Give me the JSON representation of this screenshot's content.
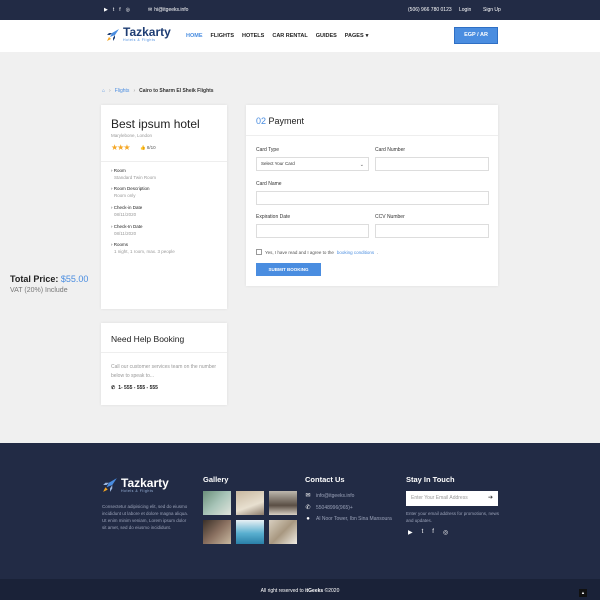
{
  "topbar": {
    "social_icons": [
      "youtube-icon",
      "twitter-icon",
      "facebook-icon",
      "instagram-icon"
    ],
    "email": "hi@itgeeks.info",
    "phone": "(506) 966 780 0123",
    "login": "Login",
    "signup": "Sign Up"
  },
  "brand": {
    "name": "Tazkarty",
    "tagline": "Hotels & Flights",
    "accent": "#4a8de0",
    "dark": "#222b45"
  },
  "nav": {
    "items": [
      "HOME",
      "FLIGHTS",
      "HOTELS",
      "CAR RENTAL",
      "GUIDES",
      "PAGES"
    ],
    "pages_caret": "▾",
    "currency_button": "EGP / AR"
  },
  "breadcrumb": {
    "home_icon": "home-icon",
    "sep": "›",
    "flights": "Flights",
    "current": "Cairo to Sharm El Sheik Flights"
  },
  "hotel": {
    "name": "Best ipsum hotel",
    "location": "Marylebone, London",
    "stars": "★★★",
    "rating": "8/10",
    "details": [
      {
        "label": "Room",
        "value": "Standard Twin Room"
      },
      {
        "label": "Room Description",
        "value": "Room only"
      },
      {
        "label": "Check-in Date",
        "value": "08/11/2020"
      },
      {
        "label": "Check-In Date",
        "value": "08/11/2020"
      },
      {
        "label": "Rooms",
        "value": "1 night, 1 room, max. 3 people"
      }
    ],
    "total_label": "Total Price:",
    "total_value": "$55.00",
    "vat": "VAT (20%) Include"
  },
  "help": {
    "title": "Need Help Booking",
    "text": "Call our customer services team on the number below to speak to...",
    "phone": "1- 555 - 555 - 555"
  },
  "payment": {
    "step": "02",
    "title": "Payment",
    "card_type_label": "Card Type",
    "card_type_value": "Select Your Card",
    "card_number_label": "Card Number",
    "card_name_label": "Card Name",
    "expiration_label": "Expiration Date",
    "ccv_label": "CCV Number",
    "agree_text": "Yes, I have read and I agree to the",
    "agree_link": "booking conditions",
    "submit": "SUBMIT BOOKING"
  },
  "footer": {
    "about": "Consectetur adipisicing elit, sed do eiusmo incididunt ut labore et dolore magna aliqua. Ut enim minim veniam, Lorem ipsum dolor sit amet, sed do eiusmo incididunt.",
    "gallery_title": "Gallery",
    "contact_title": "Contact Us",
    "contact": [
      {
        "icon": "mail-icon",
        "text": "info@itgeeks.info"
      },
      {
        "icon": "phone-icon",
        "text": "55048996(965)+"
      },
      {
        "icon": "location-icon",
        "text": "Al Noor Tower, Ibn Sina Mansoura"
      }
    ],
    "stay_title": "Stay In Touch",
    "newsletter_placeholder": "Enter Your Email Address",
    "newsletter_text": "Enter your email address for promotions, news and updates.",
    "social_icons": [
      "youtube-icon",
      "twitter-icon",
      "facebook-icon",
      "instagram-icon"
    ],
    "copyright_pre": "All right reserved to",
    "copyright_brand": "itGeeks",
    "copyright_post": "©2020"
  }
}
